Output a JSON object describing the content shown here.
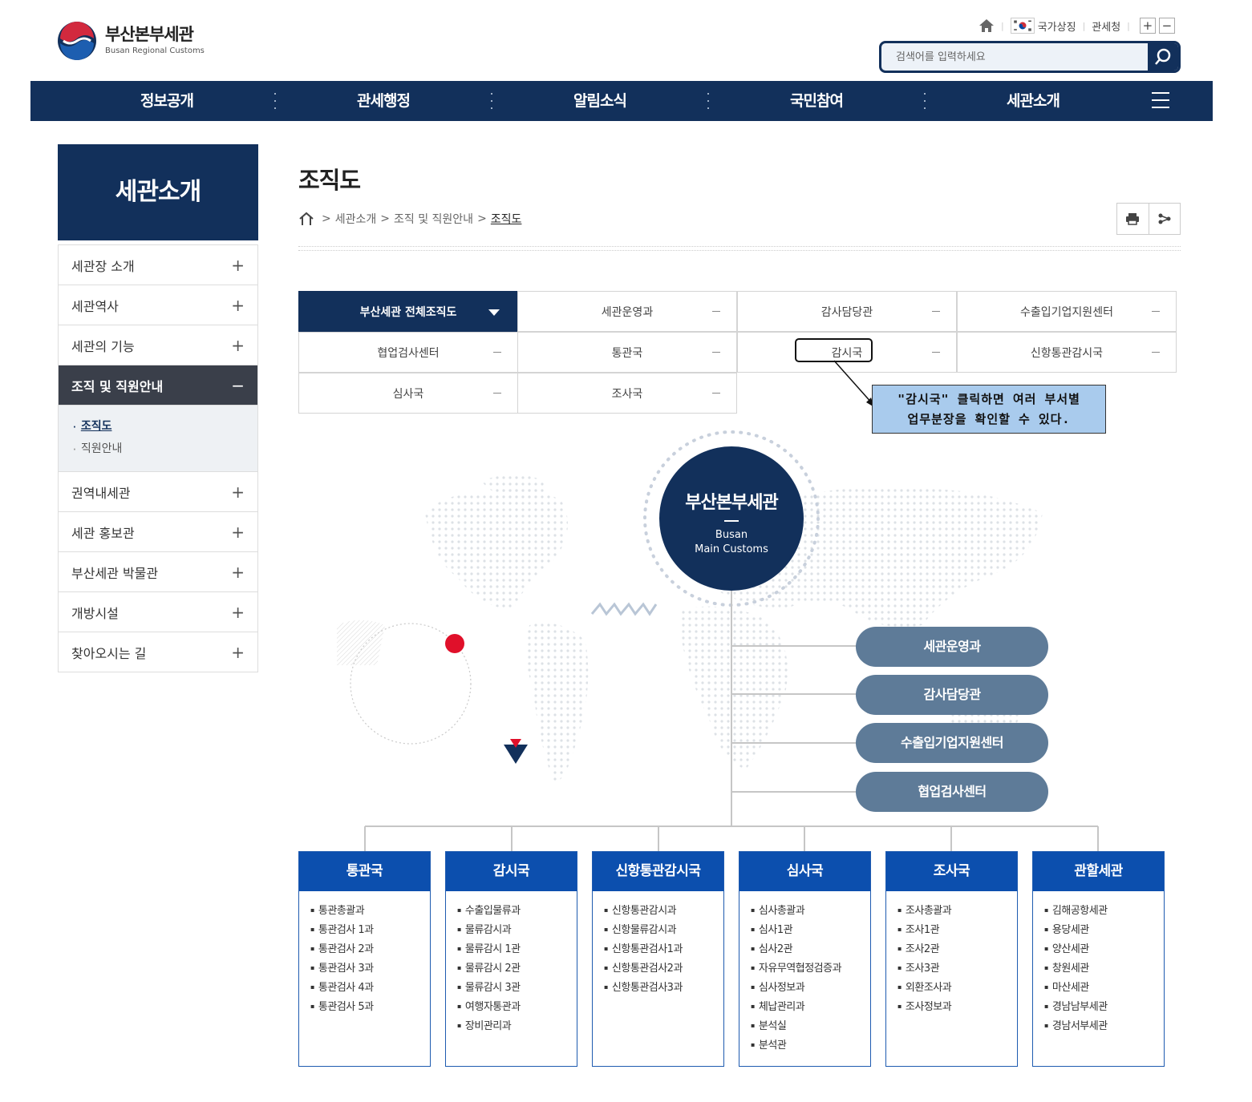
{
  "header": {
    "logo_ko": "부산본부세관",
    "logo_en": "Busan Regional Customs",
    "utility": {
      "national_symbol": "국가상징",
      "kcs": "관세청",
      "zoom_in": "+",
      "zoom_out": "−"
    },
    "search": {
      "placeholder": "검색어를 입력하세요"
    }
  },
  "gnb": {
    "items": [
      "정보공개",
      "관세행정",
      "알림소식",
      "국민참여",
      "세관소개"
    ]
  },
  "lnb": {
    "title": "세관소개",
    "items": [
      {
        "label": "세관장 소개",
        "icon": "+"
      },
      {
        "label": "세관역사",
        "icon": "+"
      },
      {
        "label": "세관의 기능",
        "icon": "+"
      },
      {
        "label": "조직 및 직원안내",
        "icon": "−"
      },
      {
        "label": "권역내세관",
        "icon": "+"
      },
      {
        "label": "세관 홍보관",
        "icon": "+"
      },
      {
        "label": "부산세관 박물관",
        "icon": "+"
      },
      {
        "label": "개방시설",
        "icon": "+"
      },
      {
        "label": "찾아오시는 길",
        "icon": "+"
      }
    ],
    "sub_items": [
      "조직도",
      "직원안내"
    ]
  },
  "page": {
    "title": "조직도",
    "breadcrumb": [
      "세관소개",
      "조직 및 직원안내",
      "조직도"
    ],
    "separator": ">"
  },
  "org_tabs": [
    "부산세관 전체조직도",
    "세관운영과",
    "감사담당관",
    "수출입기업지원센터",
    "협업검사센터",
    "통관국",
    "감시국",
    "신항통관감시국",
    "심사국",
    "조사국"
  ],
  "callout": {
    "line1": "\"감시국\" 클릭하면 여러 부서별",
    "line2": "업무분장을 확인할 수 있다."
  },
  "hq": {
    "name": "부산본부세관",
    "en1": "Busan",
    "en2": "Main Customs"
  },
  "staff_units": [
    "세관운영과",
    "감사담당관",
    "수출입기업지원센터",
    "협업검사센터"
  ],
  "bureaus": [
    {
      "name": "통관국",
      "items": [
        "통관총괄과",
        "통관검사 1과",
        "통관검사 2과",
        "통관검사 3과",
        "통관검사 4과",
        "통관검사 5과"
      ]
    },
    {
      "name": "감시국",
      "items": [
        "수출입물류과",
        "물류감시과",
        "물류감시 1관",
        "물류감시 2관",
        "물류감시 3관",
        "여행자통관과",
        "장비관리과"
      ]
    },
    {
      "name": "신항통관감시국",
      "items": [
        "신항통관감시과",
        "신항물류감시과",
        "신항통관검사1과",
        "신항통관검사2과",
        "신항통관검사3과"
      ]
    },
    {
      "name": "심사국",
      "items": [
        "심사총괄과",
        "심사1관",
        "심사2관",
        "자유무역협정검증과",
        "심사정보과",
        "체납관리과",
        "분석실",
        "분석관"
      ]
    },
    {
      "name": "조사국",
      "items": [
        "조사총괄과",
        "조사1관",
        "조사2관",
        "조사3관",
        "외환조사과",
        "조사정보과"
      ]
    },
    {
      "name": "관할세관",
      "items": [
        "김해공항세관",
        "용당세관",
        "양산세관",
        "창원세관",
        "마산세관",
        "경남남부세관",
        "경남서부세관"
      ]
    }
  ],
  "colors": {
    "navy": "#12305b",
    "bureau_blue": "#0c4fae",
    "pill": "#5e7b98",
    "callout_bg": "#a9cbed",
    "marker_red": "#e0102a"
  }
}
